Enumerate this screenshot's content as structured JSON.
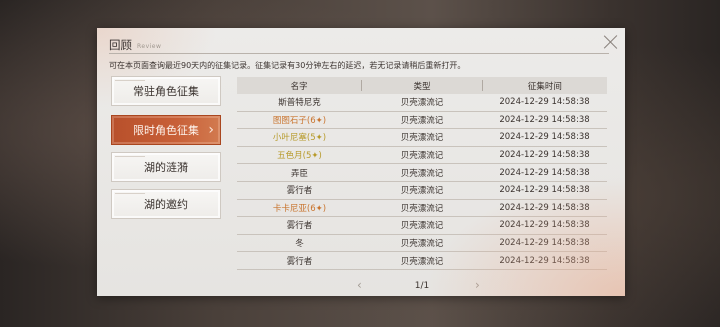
{
  "dialog": {
    "title": "回顾",
    "subtitle": "Review",
    "notice": "可在本页面查询最近90天内的征集记录。征集记录有30分钟左右的延迟，若无记录请稍后重新打开。"
  },
  "sidebar": {
    "items": [
      {
        "label": "常驻角色征集",
        "active": false
      },
      {
        "label": "限时角色征集",
        "active": true
      },
      {
        "label": "湖的涟漪",
        "active": false
      },
      {
        "label": "湖的邀约",
        "active": false
      }
    ]
  },
  "table": {
    "headers": [
      "名字",
      "类型",
      "征集时间"
    ],
    "rows": [
      {
        "name": "斯普特尼克",
        "type": "贝壳漂流记",
        "time": "2024-12-29 14:58:38",
        "style": "normal"
      },
      {
        "name": "图图石子(6✦)",
        "type": "贝壳漂流记",
        "time": "2024-12-29 14:58:38",
        "style": "orange"
      },
      {
        "name": "小叶尼塞(5✦)",
        "type": "贝壳漂流记",
        "time": "2024-12-29 14:58:38",
        "style": "gold"
      },
      {
        "name": "五色月(5✦)",
        "type": "贝壳漂流记",
        "time": "2024-12-29 14:58:38",
        "style": "gold"
      },
      {
        "name": "弄臣",
        "type": "贝壳漂流记",
        "time": "2024-12-29 14:58:38",
        "style": "normal"
      },
      {
        "name": "雾行者",
        "type": "贝壳漂流记",
        "time": "2024-12-29 14:58:38",
        "style": "normal"
      },
      {
        "name": "卡卡尼亚(6✦)",
        "type": "贝壳漂流记",
        "time": "2024-12-29 14:58:38",
        "style": "orange"
      },
      {
        "name": "雾行者",
        "type": "贝壳漂流记",
        "time": "2024-12-29 14:58:38",
        "style": "normal"
      },
      {
        "name": "冬",
        "type": "贝壳漂流记",
        "time": "2024-12-29 14:58:38",
        "style": "normal"
      },
      {
        "name": "雾行者",
        "type": "贝壳漂流记",
        "time": "2024-12-29 14:58:38",
        "style": "normal"
      }
    ]
  },
  "pager": {
    "text": "1/1"
  },
  "colors": {
    "accent": "#c05a30",
    "orange_name": "#c9742e",
    "gold_name": "#b79a2a"
  },
  "icons": {
    "close": "close-icon",
    "active_chevron": "chevron-right-icon",
    "prev": "chevron-left-icon",
    "next": "chevron-right-icon"
  }
}
